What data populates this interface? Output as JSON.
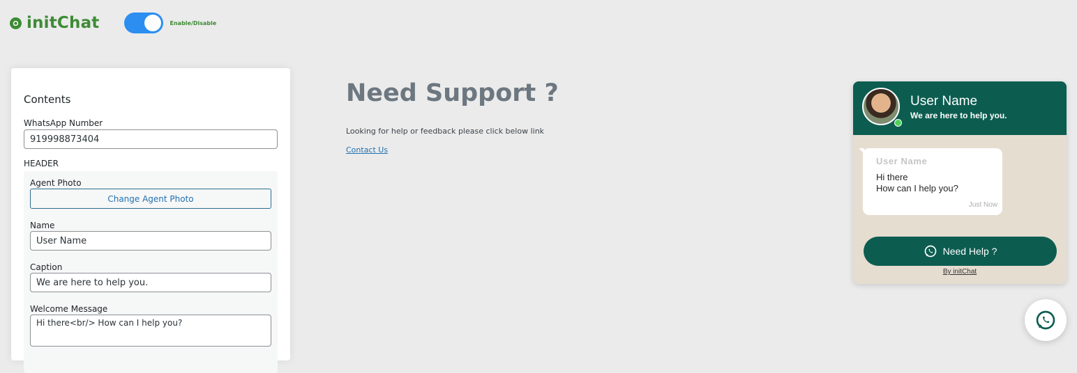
{
  "brand": {
    "name": "initChat",
    "logo_icon": "chat-bubble-icon"
  },
  "toggle": {
    "label": "Enable/Disable",
    "state": "on"
  },
  "contents_panel": {
    "title": "Contents",
    "whatsapp_label": "WhatsApp Number",
    "whatsapp_value": "919998873404",
    "header_label": "HEADER",
    "agent_photo_label": "Agent Photo",
    "change_photo_button": "Change Agent Photo",
    "name_label": "Name",
    "name_value": "User Name",
    "caption_label": "Caption",
    "caption_value": "We are here to help you.",
    "welcome_label": "Welcome Message",
    "welcome_value": "Hi there<br/> How can I help you?"
  },
  "support": {
    "title": "Need Support ?",
    "text": "Looking for help or feedback please click below link",
    "link": "Contact Us"
  },
  "widget": {
    "name": "User Name",
    "caption": "We are here to help you.",
    "bubble_name": "User Name",
    "message_line1": "Hi there",
    "message_line2": "How can I help you?",
    "time": "Just Now",
    "button": "Need Help ?",
    "credit": "By initChat",
    "colors": {
      "header": "#0c5d50",
      "body": "#e6ddd1",
      "online": "#4fd05a"
    }
  },
  "fab": {
    "icon": "whatsapp-icon"
  }
}
